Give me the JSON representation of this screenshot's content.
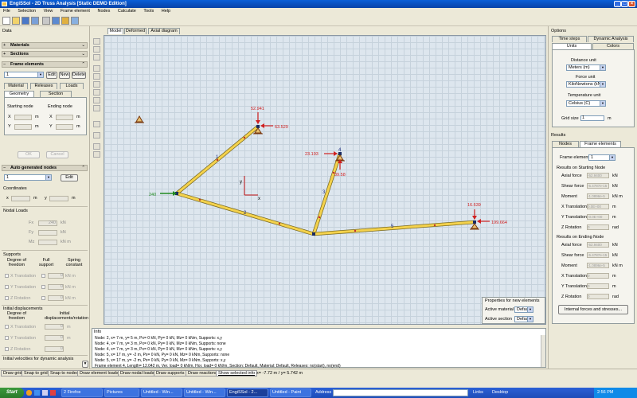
{
  "window": {
    "title": "EngiSSol - 2D Truss Analysis [Static DEMO Edition]"
  },
  "menu": [
    "File",
    "Selection",
    "View",
    "Frame element",
    "Nodes",
    "Calculate",
    "Tools",
    "Help"
  ],
  "left": {
    "data_label": "Data",
    "materials": "Materials",
    "sections": "Sections",
    "frame_elements": "Frame elements",
    "frame_select": "1",
    "edit": "Edit",
    "new": "New",
    "delete": "Delete",
    "tabs_top": [
      "Material",
      "Releases",
      "Loads"
    ],
    "tabs_bottom": [
      "Geometry",
      "Section"
    ],
    "starting_node": "Starting node",
    "ending_node": "Ending node",
    "x": "X",
    "y": "Y",
    "m": "m",
    "ok": "OK",
    "cancel": "Cancel",
    "auto_nodes": "Auto generated nodes",
    "auto_value": "1",
    "coordinates": "Coordinates",
    "x_lower": "x",
    "y_lower": "y",
    "nodal_loads": "Nodal Loads",
    "fx": "Fx",
    "fy": "Fy",
    "mz": "Mz",
    "fx_val": "240",
    "kn": "kN",
    "knm": "kN m",
    "supports": "Supports",
    "dof": "Degree of freedom",
    "full_support": "Full support",
    "spring_constant": "Spring constant",
    "x_translation": "X Translation",
    "y_translation": "Y Translation",
    "z_rotation": "Z Rotation",
    "initial_disp": "Initial displacements",
    "initial_disp_rot": "Initial displacements/rotation",
    "initial_vel": "Initial velocities for dynamic analysis",
    "zero": "0"
  },
  "draw_tabs": [
    "Model",
    "Deformed",
    "Axial diagram"
  ],
  "canvas": {
    "loads": [
      "52.941",
      "63.529",
      "23.193",
      "39.58",
      "240",
      "16.639",
      "199.664"
    ],
    "nodes": [
      "1",
      "2",
      "3",
      "4",
      "5"
    ],
    "axis_x": "x",
    "axis_y": "y"
  },
  "props_box": {
    "title": "Properties for new elements",
    "active_material": "Active material",
    "active_section": "Active section",
    "default": "Default"
  },
  "info": {
    "title": "Info",
    "lines": [
      "Node: 2, x= 7 m, y= 5 m, Px= 0 kN, Py= 0 kN, Mz= 0 kNm, Supports: x,y",
      "Node: 4, x= 7 m, y= 3 m, Px= 0 kN, Py= 0 kN, Mz= 0 kNm, Supports: none",
      "Node: 4, x= 7 m, y= 3 m, Px= 0 kN, Py= 0 kN, Mz= 0 kNm, Supports: x,y",
      "Node: 5, x= 17 m, y= -2 m, Px= 0 kN, Py= 0 kN, Mz= 0 kNm, Supports: none",
      "Node: 5, x= 17 m, y= -2 m, Px= 0 kN, Py= 0 kN, Mz= 0 kNm, Supports: x,y",
      "Frame element 4, Length= 12.042 m, Ver. load= 0 kN/m, Hor. load= 0 kN/m, Section: Default, Material: Default, Releases: no(start), no(end)"
    ]
  },
  "right": {
    "options": "Options",
    "tabs1": [
      "Time steps",
      "Dynamic Analysis"
    ],
    "tabs2": [
      "Units",
      "Colors"
    ],
    "distance_unit": "Distance unit",
    "distance_val": "Meters (m)",
    "force_unit": "Force unit",
    "force_val": "KiloNewtons (kN)",
    "temp_unit": "Temperature unit",
    "temp_val": "Celsius (C)",
    "grid_size": "Grid size",
    "grid_val": "1",
    "m": "m",
    "results": "Results",
    "rtabs": [
      "Nodes",
      "Frame elements"
    ],
    "frame_element": "Frame element",
    "fe_val": "1",
    "res_start": "Results on Starting Node",
    "res_end": "Results on Ending Node",
    "axial": "Axial force",
    "shear": "Shear force",
    "moment": "Moment",
    "xt": "X Translation",
    "yt": "Y Translation",
    "zr": "Z Rotation",
    "kn": "kN",
    "knm": "kN m",
    "rad": "rad",
    "start_vals": [
      "-52.9400",
      "-5.4787e-15",
      "-1.0896e-5",
      "0.0E+00",
      "-0.0E+00",
      "0"
    ],
    "end_vals": [
      "-52.9400",
      "-5.4787e-15",
      "-1.0896e-5",
      "0",
      "0",
      "0"
    ],
    "internal_btn": "Internal forces and stresses..."
  },
  "status": {
    "buttons": [
      "Draw grid",
      "Snap to grid",
      "Snap to nodes",
      "Draw element loads",
      "Draw nodal loads",
      "Draw supports",
      "Draw reactions",
      "Show selected info"
    ],
    "coords": "x= -7.72 m / y= 5.742 m"
  },
  "taskbar": {
    "start": "Start",
    "tasks": [
      "2 Firefox",
      "Pictures",
      "Untitled - Win...",
      "Untitled - Win...",
      "EngiSSol - 2...",
      "Untitled - Paint"
    ],
    "address": "Address",
    "links": "Links",
    "desktop": "Desktop",
    "clock": "2:56 PM"
  }
}
